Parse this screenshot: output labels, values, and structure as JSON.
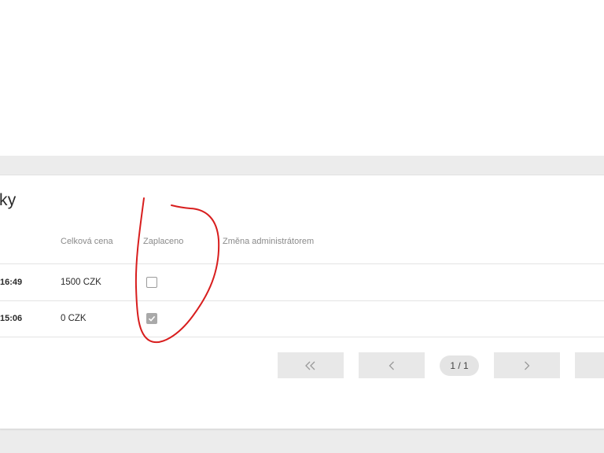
{
  "card": {
    "title": "ky"
  },
  "table": {
    "headers": [
      "Celková cena",
      "Zaplaceno",
      "Změna administrátorem"
    ],
    "rows": [
      {
        "time": "16:49",
        "price": "1500 CZK",
        "paid": false
      },
      {
        "time": "15:06",
        "price": "0 CZK",
        "paid": true
      }
    ]
  },
  "pagination": {
    "first_icon": "double-chevron-left-icon",
    "prev_icon": "chevron-left-icon",
    "indicator": "1 / 1",
    "next_icon": "chevron-right-icon"
  },
  "colors": {
    "annotation": "#d81e1e",
    "page_bg": "#ececec",
    "card_bg": "#ffffff",
    "button_bg": "#e8e8e8"
  }
}
